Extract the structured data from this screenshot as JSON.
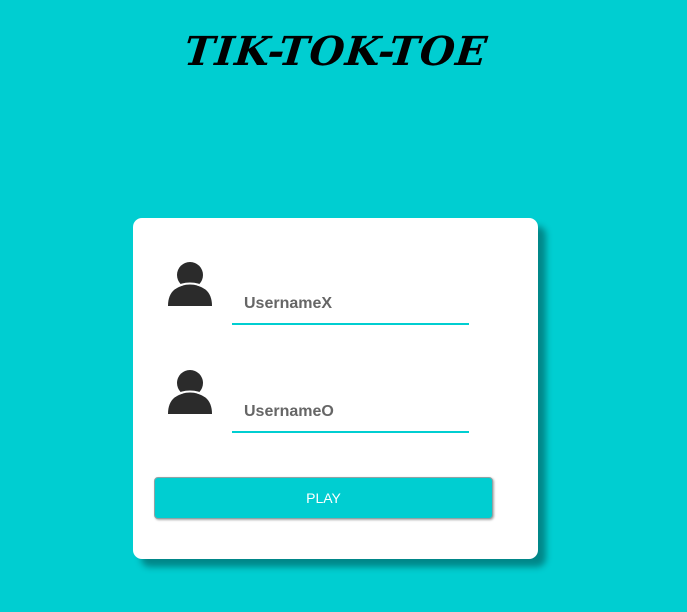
{
  "app": {
    "title": "TIK-TOK-TOE"
  },
  "form": {
    "player_x": {
      "icon": "user-icon",
      "value": "",
      "placeholder": "UsernameX"
    },
    "player_o": {
      "icon": "user-icon",
      "value": "",
      "placeholder": "UsernameO"
    },
    "play_label": "PLAY"
  },
  "colors": {
    "background": "#00ced1",
    "card": "#ffffff",
    "accent": "#00ced1",
    "icon": "#2b2b2b",
    "button_text": "#ffffff"
  }
}
